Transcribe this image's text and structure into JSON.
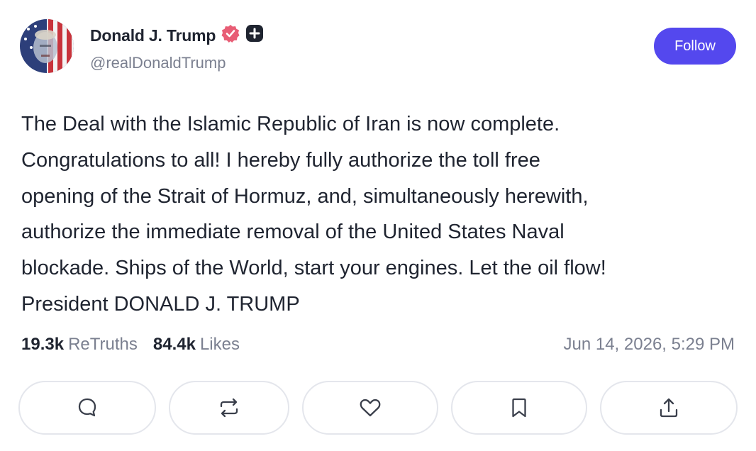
{
  "author": {
    "display_name": "Donald J. Trump",
    "handle": "@realDonaldTrump",
    "verified_badge_icon": "verified-check-icon",
    "verified_badge_color": "#e85d75",
    "plus_badge_icon": "plus-badge-icon"
  },
  "follow_button": {
    "label": "Follow",
    "color": "#5448ee"
  },
  "post": {
    "lines": [
      "The Deal with the Islamic Republic of Iran is now complete.",
      "Congratulations to all! I hereby fully authorize the toll free",
      "opening of the Strait of Hormuz, and, simultaneously herewith,",
      "authorize the immediate removal of the United States Naval",
      "blockade. Ships of the World, start your engines. Let the oil flow!",
      "President DONALD J. TRUMP"
    ]
  },
  "stats": {
    "retruths_count": "19.3k",
    "retruths_label": "ReTruths",
    "likes_count": "84.4k",
    "likes_label": "Likes"
  },
  "timestamp": "Jun 14, 2026, 5:29 PM",
  "actions": [
    {
      "name": "reply",
      "icon": "comment-icon"
    },
    {
      "name": "retruth",
      "icon": "repost-icon"
    },
    {
      "name": "like",
      "icon": "heart-icon"
    },
    {
      "name": "bookmark",
      "icon": "bookmark-icon"
    },
    {
      "name": "share",
      "icon": "share-icon"
    }
  ]
}
